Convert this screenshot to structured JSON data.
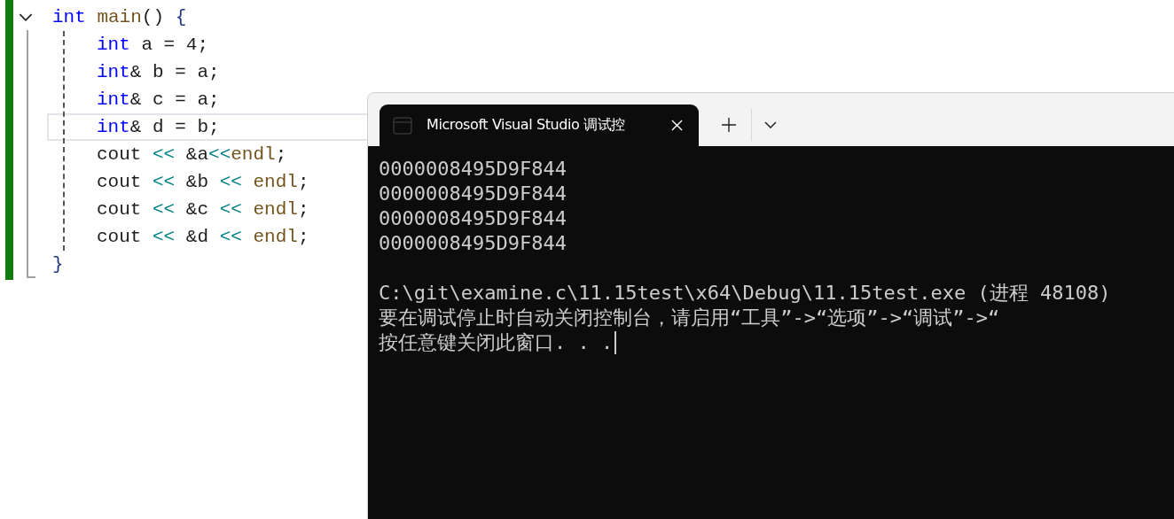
{
  "editor": {
    "lines": [
      {
        "expanded": true,
        "current": false,
        "tokens": [
          {
            "text": "int",
            "kind": "keyword"
          },
          {
            "text": " main",
            "kind": "func"
          },
          {
            "text": "() ",
            "kind": "plain"
          },
          {
            "text": "{",
            "kind": "brace"
          }
        ],
        "children": [
          {
            "current": false,
            "tokens": [
              {
                "text": "int",
                "kind": "keyword"
              },
              {
                "text": " a = 4;",
                "kind": "plain"
              }
            ]
          },
          {
            "current": false,
            "tokens": [
              {
                "text": "int",
                "kind": "keyword"
              },
              {
                "text": "& b = a;",
                "kind": "plain"
              }
            ]
          },
          {
            "current": false,
            "tokens": [
              {
                "text": "int",
                "kind": "keyword"
              },
              {
                "text": "& c = a;",
                "kind": "plain"
              }
            ]
          },
          {
            "current": true,
            "tokens": [
              {
                "text": "int",
                "kind": "keyword"
              },
              {
                "text": "& d = b;",
                "kind": "plain"
              }
            ]
          },
          {
            "current": false,
            "tokens": [
              {
                "text": "cout ",
                "kind": "plain"
              },
              {
                "text": "<<",
                "kind": "stream"
              },
              {
                "text": " &a",
                "kind": "plain"
              },
              {
                "text": "<<",
                "kind": "stream"
              },
              {
                "text": "endl",
                "kind": "func"
              },
              {
                "text": ";",
                "kind": "plain"
              }
            ]
          },
          {
            "current": false,
            "tokens": [
              {
                "text": "cout ",
                "kind": "plain"
              },
              {
                "text": "<<",
                "kind": "stream"
              },
              {
                "text": " &b ",
                "kind": "plain"
              },
              {
                "text": "<<",
                "kind": "stream"
              },
              {
                "text": " endl",
                "kind": "func"
              },
              {
                "text": ";",
                "kind": "plain"
              }
            ]
          },
          {
            "current": false,
            "tokens": [
              {
                "text": "cout ",
                "kind": "plain"
              },
              {
                "text": "<<",
                "kind": "stream"
              },
              {
                "text": " &c ",
                "kind": "plain"
              },
              {
                "text": "<<",
                "kind": "stream"
              },
              {
                "text": " endl",
                "kind": "func"
              },
              {
                "text": ";",
                "kind": "plain"
              }
            ]
          },
          {
            "current": false,
            "tokens": [
              {
                "text": "cout ",
                "kind": "plain"
              },
              {
                "text": "<<",
                "kind": "stream"
              },
              {
                "text": " &d ",
                "kind": "plain"
              },
              {
                "text": "<<",
                "kind": "stream"
              },
              {
                "text": " endl",
                "kind": "func"
              },
              {
                "text": ";",
                "kind": "plain"
              }
            ]
          }
        ]
      },
      {
        "current": false,
        "tokens": [
          {
            "text": "}",
            "kind": "brace"
          }
        ]
      }
    ]
  },
  "console": {
    "tabs": [
      {
        "title": "Microsoft Visual Studio 调试控",
        "selected": true
      }
    ],
    "output": [
      [
        "0000008495D9F844",
        "0000008495D9F844",
        "0000008495D9F844",
        "0000008495D9F844"
      ],
      [
        "C:\\git\\examine.c\\11.15test\\x64\\Debug\\11.15test.exe (进程 48108)",
        "要在调试停止时自动关闭控制台，请启用“工具”->“选项”->“调试”->“",
        "按任意键关闭此窗口. . ."
      ]
    ],
    "cursor": true
  }
}
